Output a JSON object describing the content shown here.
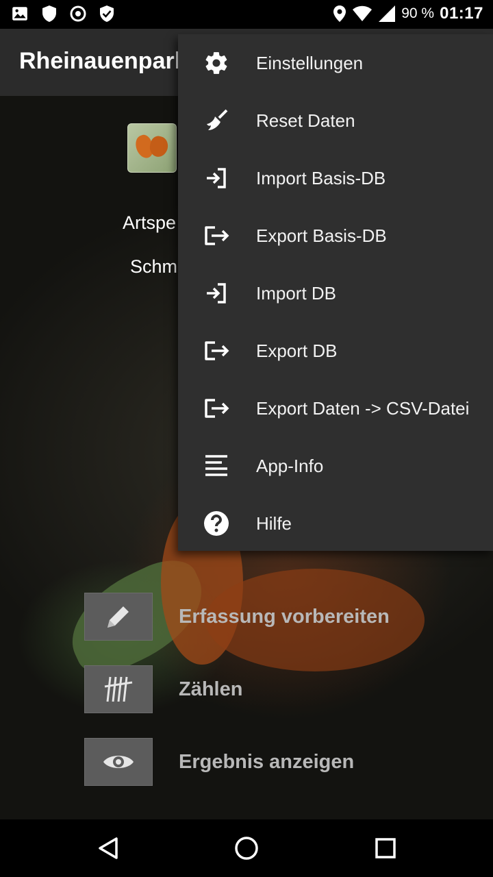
{
  "status_bar": {
    "icons": [
      "image-icon",
      "shield-icon",
      "target-icon",
      "shield-check-icon",
      "location-icon",
      "wifi-icon",
      "cell-signal-icon"
    ],
    "battery_percent": "90 %",
    "time": "01:17"
  },
  "app_bar": {
    "title": "Rheinauenpark"
  },
  "content": {
    "label_1": "Artspe",
    "label_2": "Schm",
    "actions": [
      {
        "label": "Erfassung vorbereiten",
        "icon": "pencil-icon"
      },
      {
        "label": "Zählen",
        "icon": "tally-icon"
      },
      {
        "label": "Ergebnis anzeigen",
        "icon": "eye-icon"
      }
    ]
  },
  "menu": {
    "items": [
      {
        "label": "Einstellungen",
        "icon": "gear-icon"
      },
      {
        "label": "Reset Daten",
        "icon": "broom-icon"
      },
      {
        "label": "Import Basis-DB",
        "icon": "import-icon"
      },
      {
        "label": "Export Basis-DB",
        "icon": "export-icon"
      },
      {
        "label": "Import DB",
        "icon": "import-icon"
      },
      {
        "label": "Export DB",
        "icon": "export-icon"
      },
      {
        "label": "Export Daten -> CSV-Datei",
        "icon": "export-icon"
      },
      {
        "label": "App-Info",
        "icon": "text-lines-icon"
      },
      {
        "label": "Hilfe",
        "icon": "help-icon"
      }
    ]
  },
  "nav_bar": {
    "buttons": [
      "back-icon",
      "home-icon",
      "recents-icon"
    ]
  },
  "colors": {
    "app_bar": "#2b2b2b",
    "menu_bg": "#2f2f2f",
    "action_box": "#5c5c5c"
  }
}
